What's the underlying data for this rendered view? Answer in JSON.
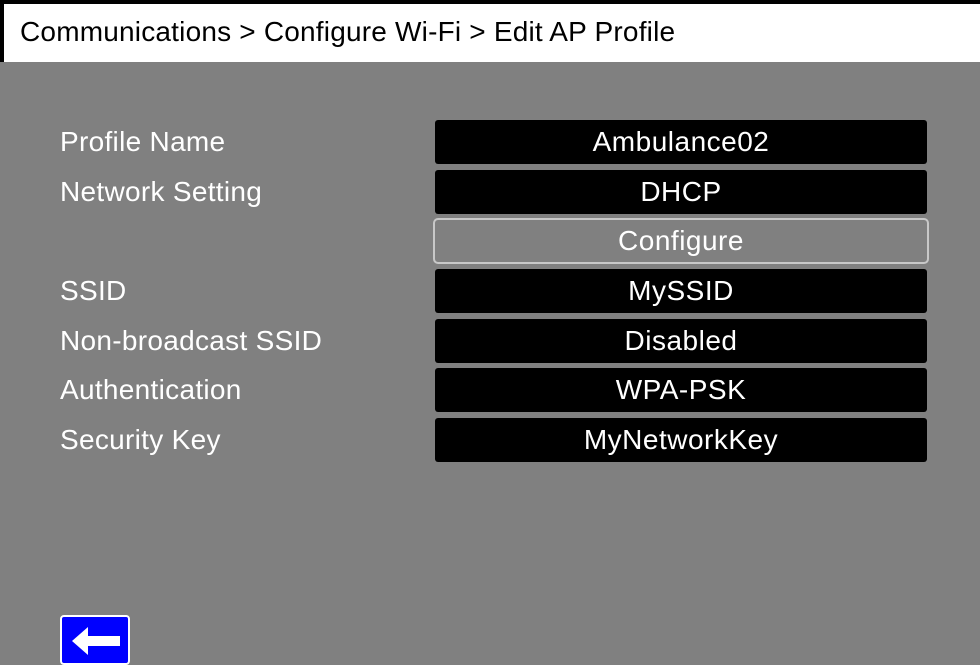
{
  "header": {
    "breadcrumb": "Communications > Configure Wi-Fi > Edit AP Profile"
  },
  "form": {
    "profile_name": {
      "label": "Profile Name",
      "value": "Ambulance02"
    },
    "network_setting": {
      "label": "Network Setting",
      "value": "DHCP"
    },
    "configure_button": {
      "label": "Configure"
    },
    "ssid": {
      "label": "SSID",
      "value": "MySSID"
    },
    "non_broadcast_ssid": {
      "label": "Non-broadcast SSID",
      "value": "Disabled"
    },
    "authentication": {
      "label": "Authentication",
      "value": "WPA-PSK"
    },
    "security_key": {
      "label": "Security Key",
      "value": "MyNetworkKey"
    }
  },
  "footer": {
    "back_icon": "left-arrow-icon"
  },
  "colors": {
    "background": "#808080",
    "field_background": "#000000",
    "text": "#ffffff",
    "back_button": "#0000ff"
  }
}
